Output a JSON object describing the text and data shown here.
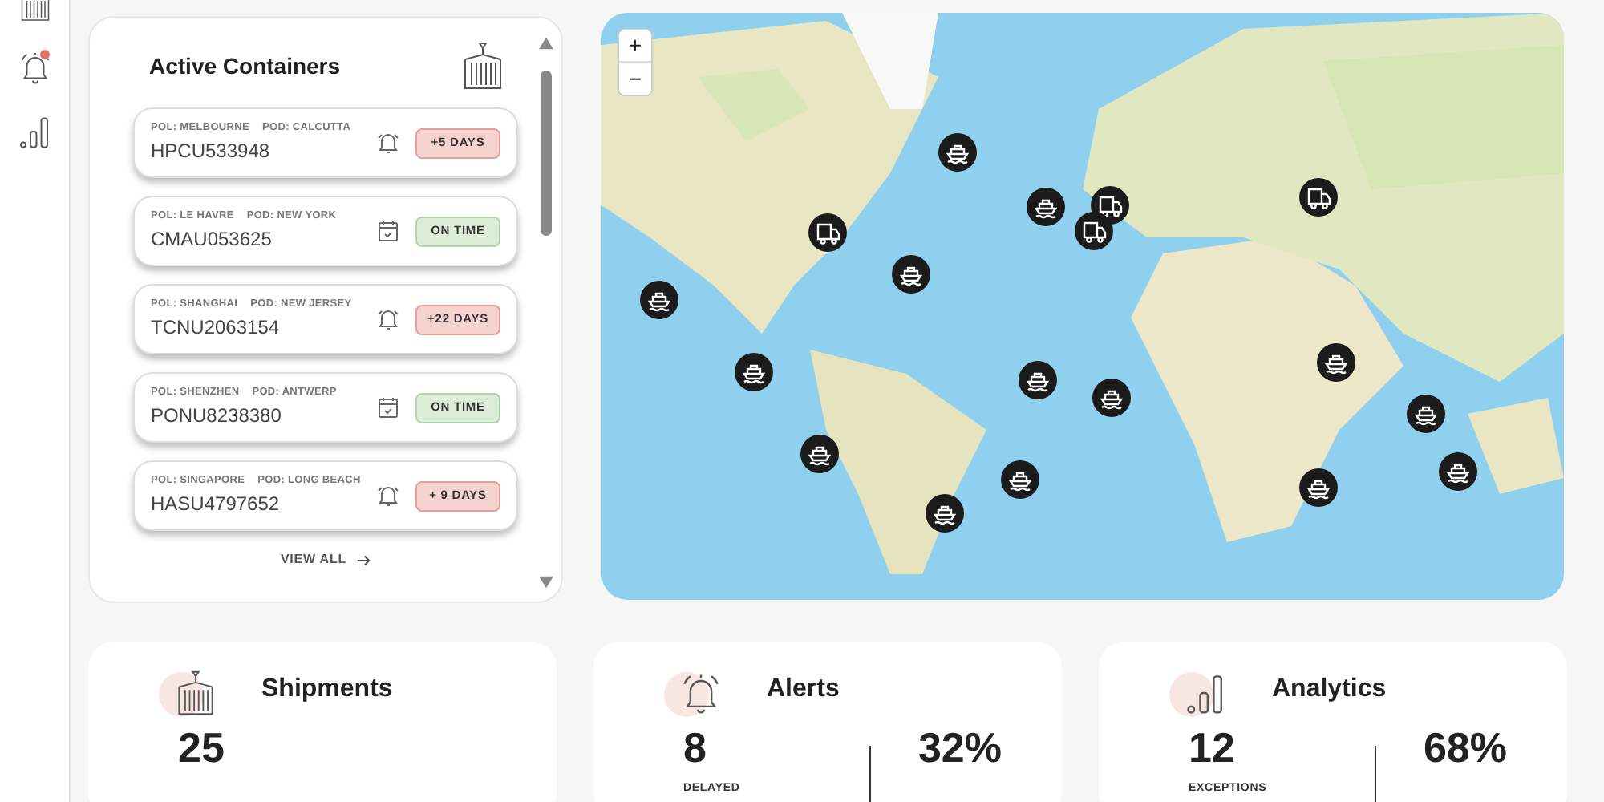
{
  "sidebar": {
    "items": [
      {
        "kind": "container",
        "alert": false
      },
      {
        "kind": "bell",
        "alert": true
      },
      {
        "kind": "chart",
        "alert": false
      }
    ]
  },
  "containers_panel": {
    "title": "Active Containers",
    "items": [
      {
        "pol": "POL: MELBOURNE",
        "pod": "POD: CALCUTTA",
        "number": "HPCU533948",
        "delayed": true,
        "badge": "+5 DAYS"
      },
      {
        "pol": "POL: LE HAVRE",
        "pod": "POD: NEW YORK",
        "number": "CMAU053625",
        "delayed": false,
        "badge": "ON TIME"
      },
      {
        "pol": "POL: SHANGHAI",
        "pod": "POD: NEW JERSEY",
        "number": "TCNU2063154",
        "delayed": true,
        "badge": "+22 DAYS"
      },
      {
        "pol": "POL: SHENZHEN",
        "pod": "POD: ANTWERP",
        "number": "PONU8238380",
        "delayed": false,
        "badge": "ON TIME"
      },
      {
        "pol": "POL: SINGAPORE",
        "pod": "POD: LONG BEACH",
        "number": "HASU4797652",
        "delayed": true,
        "badge": "+ 9 DAYS"
      }
    ],
    "view_all": "VIEW ALL"
  },
  "map": {
    "zoom_in": "+",
    "zoom_out": "−",
    "markers": [
      {
        "kind": "ship"
      },
      {
        "kind": "truck"
      },
      {
        "kind": "ship"
      },
      {
        "kind": "ship"
      },
      {
        "kind": "ship"
      },
      {
        "kind": "ship"
      },
      {
        "kind": "ship"
      },
      {
        "kind": "ship"
      },
      {
        "kind": "ship"
      },
      {
        "kind": "ship"
      },
      {
        "kind": "ship"
      },
      {
        "kind": "truck"
      },
      {
        "kind": "truck"
      },
      {
        "kind": "truck"
      },
      {
        "kind": "ship"
      },
      {
        "kind": "ship"
      },
      {
        "kind": "ship"
      },
      {
        "kind": "ship"
      }
    ]
  },
  "summary_cards": [
    {
      "kind": "container",
      "title": "Shipments",
      "stats": [
        {
          "value": "25"
        }
      ]
    },
    {
      "kind": "bell",
      "title": "Alerts",
      "stats": [
        {
          "value": "8",
          "label": "DELAYED"
        },
        {
          "value": "32%"
        }
      ]
    },
    {
      "kind": "chart",
      "title": "Analytics",
      "stats": [
        {
          "value": "12",
          "label": "EXCEPTIONS"
        },
        {
          "value": "68%"
        }
      ]
    }
  ]
}
